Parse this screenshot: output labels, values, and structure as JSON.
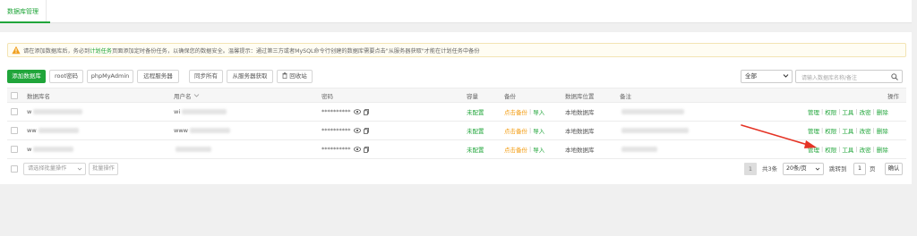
{
  "tabs": {
    "active": "数据库管理"
  },
  "notice": {
    "part1": "请在添加数据库后，务必到",
    "link": "计划任务",
    "part2": "页面添加定时备份任务，以确保您的数据安全。温馨提示：通过第三方或者MySQL命令行创建的数据库需要点击\"从服务器获取\"才能在计划任务中备份"
  },
  "toolbar": {
    "add_db": "添加数据库",
    "root_pwd": "root密码",
    "phpmyadmin": "phpMyAdmin",
    "remote_server": "远程服务器",
    "sync_all": "同步所有",
    "fetch_server": "从服务器获取",
    "recycle": "回收站",
    "filter_value": "全部",
    "search_placeholder": "请输入数据库名称/备注"
  },
  "table": {
    "headers": {
      "name": "数据库名",
      "user": "用户名",
      "password": "密码",
      "capacity": "容量",
      "backup": "备份",
      "location": "数据库位置",
      "remark": "备注",
      "actions": "操作"
    },
    "rows": [
      {
        "name": "w",
        "user": "wi",
        "password": "**********",
        "capacity": "未配置",
        "backup_link": "点击备份",
        "import": "导入",
        "location": "本地数据库"
      },
      {
        "name": "ww",
        "user": "www",
        "password": "**********",
        "capacity": "未配置",
        "backup_link": "点击备份",
        "import": "导入",
        "location": "本地数据库"
      },
      {
        "name": "w",
        "user": "",
        "password": "**********",
        "capacity": "未配置",
        "backup_link": "点击备份",
        "import": "导入",
        "location": "本地数据库"
      }
    ],
    "actions": {
      "manage": "管理",
      "perm": "权限",
      "tools": "工具",
      "pwd": "改密",
      "delete": "删除"
    }
  },
  "footer": {
    "batch_select": "请选择批量操作",
    "batch_btn": "批量操作",
    "page_current": "1",
    "total": "共3条",
    "per_page": "20条/页",
    "goto_label": "跳转到",
    "goto_value": "1",
    "page_unit": "页",
    "confirm": "确认"
  },
  "colors": {
    "accent": "#20a53a",
    "warning": "#f39c12",
    "arrow": "#e53325"
  }
}
